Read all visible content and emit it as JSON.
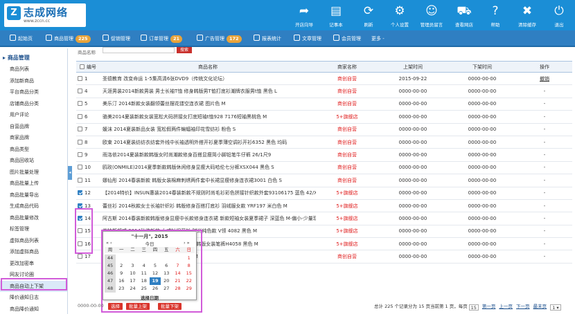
{
  "logo": {
    "mark": "Z",
    "title": "志成网络",
    "subtitle": "www.zccn.cc"
  },
  "topnav": [
    {
      "label": "开店向导",
      "icon": "share-icon"
    },
    {
      "label": "记事本",
      "icon": "notepad-icon"
    },
    {
      "label": "刷新",
      "icon": "refresh-icon"
    },
    {
      "label": "个人设置",
      "icon": "gear-icon"
    },
    {
      "label": "管理员留言",
      "icon": "message-icon"
    },
    {
      "label": "查看网店",
      "icon": "cart-icon"
    },
    {
      "label": "帮助",
      "icon": "help-icon"
    },
    {
      "label": "清除缓存",
      "icon": "clear-icon"
    },
    {
      "label": "退出",
      "icon": "power-icon"
    }
  ],
  "menubar": [
    {
      "label": "起始页",
      "badge": ""
    },
    {
      "label": "商品管理",
      "badge": "225",
      "badge_color": "#e8a33a"
    },
    {
      "label": "促销管理",
      "badge": ""
    },
    {
      "label": "订单管理",
      "badge": "21",
      "badge_color": "#e8a33a"
    },
    {
      "label": "广告管理",
      "badge": "172",
      "badge_color": "#e8a33a"
    },
    {
      "label": "报表统计",
      "badge": ""
    },
    {
      "label": "文章管理",
      "badge": ""
    },
    {
      "label": "会员管理",
      "badge": ""
    },
    {
      "label": "更多 -",
      "badge": ""
    }
  ],
  "sidebar": {
    "heading": "商品管理",
    "items": [
      "商品列表",
      "添加新商品",
      "平台商品分类",
      "店铺商品分类",
      "用户评论",
      "自营品牌",
      "商家品牌",
      "商品类型",
      "商品回收站",
      "图片批量处理",
      "商品批量上传",
      "商品批量导出",
      "生成商品代码",
      "商品批量修改",
      "标签管理",
      "虚拟商品列表",
      "添加虚拟商品",
      "更改加密串",
      "网友讨论圈",
      "商品自动上下架",
      "降价通知日志",
      "商品降价通知"
    ],
    "active_index": 19
  },
  "search": {
    "label": "商品名称",
    "button": "搜索"
  },
  "table": {
    "headers": [
      "编号",
      "商品名称",
      "商家名称",
      "上架时间",
      "下架时间",
      "操作"
    ],
    "rows": [
      {
        "id": "1",
        "name": "圣德教育 改变命运 1-5集高清6张DVD9（传统文化论坛）",
        "shop": "商创自营",
        "on": "2015-09-22",
        "off": "0000-00-00",
        "op": "撤销",
        "checked": false
      },
      {
        "id": "4",
        "name": "天涯男装2014新款男装 男士长袖T恤 修身韩版男T恤打底衫潮牌衣服男t恤 黑色 L",
        "shop": "商创自营",
        "on": "0000-00-00",
        "off": "0000-00-00",
        "op": "-",
        "checked": false
      },
      {
        "id": "5",
        "name": "美乐汀 2014新款女装翻领蕾丝摆花镂空连衣裙 图片色 M",
        "shop": "商创自营",
        "on": "0000-00-00",
        "off": "0000-00-00",
        "op": "-",
        "checked": false
      },
      {
        "id": "6",
        "name": "骆美2014夏装新款女装宽松大码拼接女打底短袖t恤928 7176短袖黑桃色 M",
        "shop": "5+旗舰店",
        "on": "0000-00-00",
        "off": "0000-00-00",
        "op": "-",
        "checked": false
      },
      {
        "id": "7",
        "name": "媛沫 2014夏装新品女装 宽松假两件蝙蝠袖印花雪纺衫 粉色 S",
        "shop": "商创自营",
        "on": "0000-00-00",
        "off": "0000-00-00",
        "op": "-",
        "checked": false
      },
      {
        "id": "8",
        "name": "欧束 2014夏装纺纺衣纺套外线中长袖透明外搭开衫夏季薄空调衫开衫6352 黑色 均码",
        "shop": "商创自营",
        "on": "0000-00-00",
        "off": "0000-00-00",
        "op": "-",
        "checked": false
      },
      {
        "id": "9",
        "name": "雨洛依2014夏装新款韩版女时尚潮款修身百搭显瘦简小脚铅笔牛仔裤 26/1尺9",
        "shop": "商创自营",
        "on": "0000-00-00",
        "off": "0000-00-00",
        "op": "-",
        "checked": false
      },
      {
        "id": "10",
        "name": "鸥玫(ONMILE)2014夏季新款韩版休闲修身显瘦大码哈伦七分裤XSX044 黑色 S",
        "shop": "商创自营",
        "on": "0000-00-00",
        "off": "0000-00-00",
        "op": "-",
        "checked": false
      },
      {
        "id": "11",
        "name": "娜仙彤 2014春装新款 韩版女装棉麻刺绣两件套中长裙显瘦修身连衣裙3001 白色 S",
        "shop": "商创自营",
        "on": "0000-00-00",
        "off": "0000-00-00",
        "op": "-",
        "checked": false
      },
      {
        "id": "12",
        "name": "【2014特价】INSUN惠装2014春装新款不规则时尚毛衫彩色拼接针织款外套93106175 蓝色 42/XL",
        "shop": "5+旗舰店",
        "on": "0000-00-00",
        "off": "0000-00-00",
        "op": "-",
        "checked": true
      },
      {
        "id": "13",
        "name": "蕾丝衫 2014秋款女士长袖针织衫 韩版修身百搭打底衫 羽绒服女款 YRF197 米白色 M",
        "shop": "5+旗舰店",
        "on": "0000-00-00",
        "off": "0000-00-00",
        "op": "-",
        "checked": true
      },
      {
        "id": "14",
        "name": "阿古斯 2014春装新款韩版修身显瘦中长款修身连衣裙 新款短袖女装夏季裙子 深蓝色 M-偏小-少量现",
        "shop": "5+旗舰店",
        "on": "0000-00-00",
        "off": "0000-00-00",
        "op": "-",
        "checked": true
      },
      {
        "id": "15",
        "name": "美特斯邦威 2014秋装新款 女式针织开衫 时尚纯色款 V领 4082 黑色 M",
        "shop": "5+旗舰店",
        "on": "0000-00-00",
        "off": "0000-00-00",
        "op": "-",
        "checked": false
      },
      {
        "id": "16",
        "name": "春装新款女士长袖牛仔裤 修身铅笔裤小脚裤韩版女装笔裤H4058 黑色 M",
        "shop": "5+旗舰店",
        "on": "0000-00-00",
        "off": "0000-00-00",
        "op": "-",
        "checked": false
      },
      {
        "id": "17",
        "name": "韩版百搭女装 2014春装新品 卫衣 图片色 M",
        "shop": "商创自营",
        "on": "0000-00-00",
        "off": "0000-00-00",
        "op": "-",
        "checked": false
      }
    ]
  },
  "datepicker": {
    "title": "\"十一月\", 2015",
    "nav_left": "« ‹",
    "nav_right": "› »",
    "today": "今日",
    "weekdays": [
      "周",
      "一",
      "二",
      "三",
      "四",
      "五",
      "六",
      "日"
    ],
    "weeks": [
      {
        "wk": "44",
        "days": [
          "",
          "",
          "",
          "",
          "",
          "",
          "1"
        ]
      },
      {
        "wk": "45",
        "days": [
          "2",
          "3",
          "4",
          "5",
          "6",
          "7",
          "8"
        ]
      },
      {
        "wk": "46",
        "days": [
          "9",
          "10",
          "11",
          "12",
          "13",
          "14",
          "15"
        ]
      },
      {
        "wk": "47",
        "days": [
          "16",
          "17",
          "18",
          "19",
          "20",
          "21",
          "22"
        ]
      },
      {
        "wk": "48",
        "days": [
          "23",
          "24",
          "25",
          "26",
          "27",
          "28",
          "29"
        ]
      }
    ],
    "today_day": "19",
    "footer": "选择日期"
  },
  "buttons": {
    "select": "选择",
    "batch_on": "批量上架",
    "batch_off": "批量下架"
  },
  "bottom_left": "0000-00-00",
  "pager": {
    "summary": "总计 225 个记录分为 15 页当前第 1 页，每页",
    "per_page": "15",
    "first": "第一页",
    "prev": "上一页",
    "next": "下一页",
    "last": "最末页",
    "page_select": "1"
  },
  "colors": {
    "header_bg": "#1b8ed6",
    "menubar_bg": "#2f7fc2",
    "highlight": "#d15bd9",
    "red": "#e02020"
  }
}
